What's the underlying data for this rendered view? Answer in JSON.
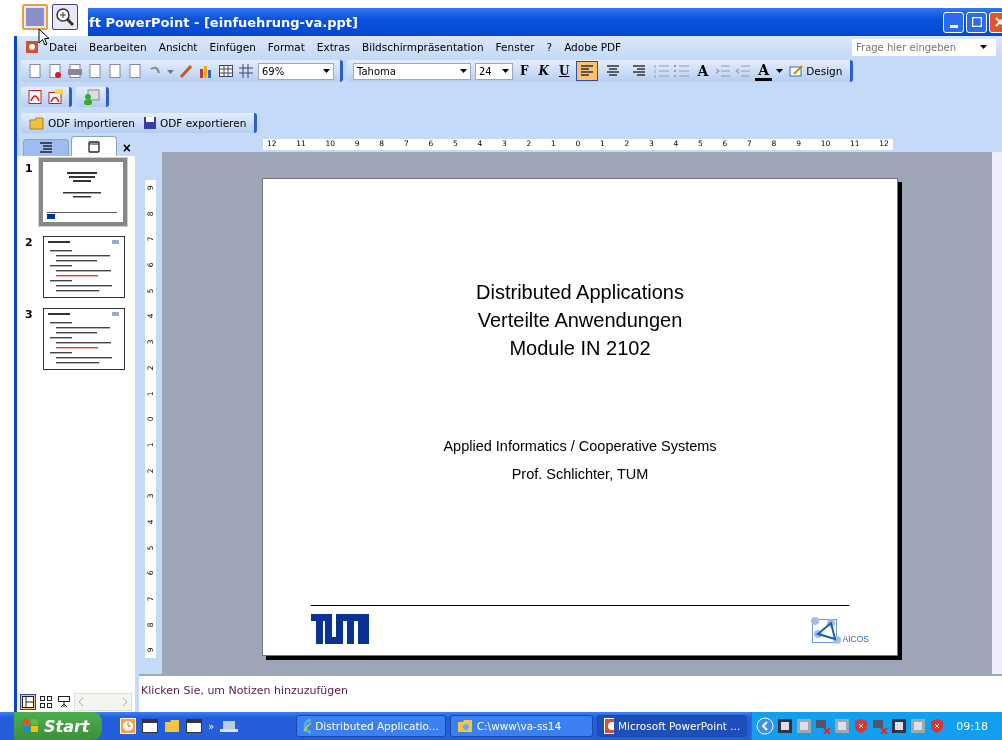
{
  "title_bar": {
    "title": "ft PowerPoint - [einfuehrung-va.ppt]"
  },
  "menu": [
    "Datei",
    "Bearbeiten",
    "Ansicht",
    "Einfügen",
    "Format",
    "Extras",
    "Bildschirmpräsentation",
    "Fenster",
    "?",
    "Adobe PDF"
  ],
  "help_field": {
    "placeholder": "Frage hier eingeben"
  },
  "standard_toolbar": {
    "zoom": "69%"
  },
  "formatting_toolbar": {
    "font": "Tahoma",
    "size": "24",
    "bold": "F",
    "italic": "K",
    "underline": "U",
    "align": [
      {
        "selected": true
      },
      {
        "selected": false
      },
      {
        "selected": false
      }
    ],
    "grow_font": "A",
    "font_color": "A",
    "design": "Design"
  },
  "odf_toolbar": {
    "import": "ODF importieren",
    "export": "ODF exportieren"
  },
  "panel": {
    "tabs": [
      {
        "kind": "outline",
        "selected": false
      },
      {
        "kind": "slides",
        "selected": true
      }
    ],
    "close": "×",
    "slides": [
      {
        "number": "1",
        "selected": true
      },
      {
        "number": "2",
        "selected": false
      },
      {
        "number": "3",
        "selected": false
      }
    ]
  },
  "ruler": {
    "horizontal": [
      "12",
      "11",
      "10",
      "9",
      "8",
      "7",
      "6",
      "5",
      "4",
      "3",
      "2",
      "1",
      "0",
      "1",
      "2",
      "3",
      "4",
      "5",
      "6",
      "7",
      "8",
      "9",
      "10",
      "11",
      "12"
    ],
    "vertical": [
      "9",
      "8",
      "7",
      "6",
      "5",
      "4",
      "3",
      "2",
      "1",
      "0",
      "1",
      "2",
      "3",
      "4",
      "5",
      "6",
      "7",
      "8",
      "9"
    ]
  },
  "slide": {
    "title_lines": [
      "Distributed Applications",
      "Verteilte Anwendungen",
      "Module IN 2102"
    ],
    "subtitle_lines": [
      "Applied Informatics / Cooperative Systems",
      "Prof. Schlichter, TUM"
    ],
    "logo_text": "AICOS"
  },
  "notes": {
    "text": "Klicken Sie, um Notizen hinzuzufügen"
  },
  "taskbar": {
    "start": "Start",
    "more": "»",
    "tasks": [
      {
        "kind": "browser",
        "label": "Distributed Applicatio...",
        "selected": false
      },
      {
        "kind": "folder",
        "label": "C:\\www\\va-ss14",
        "selected": false
      },
      {
        "kind": "powerpoint",
        "label": "Microsoft PowerPoint ...",
        "selected": true
      }
    ],
    "time": "09:18"
  }
}
